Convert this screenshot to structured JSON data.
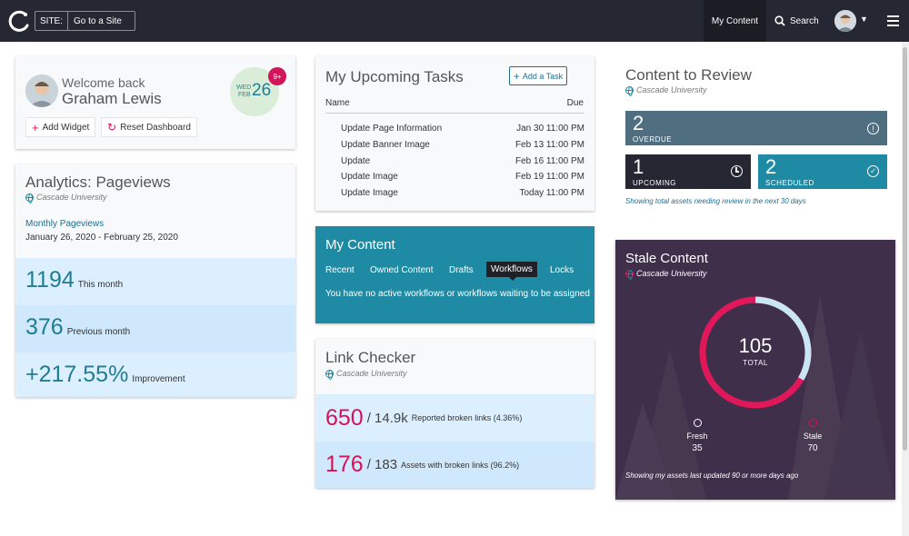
{
  "topbar": {
    "site_label": "SITE:",
    "site_value": "Go to a Site",
    "my_content": "My Content",
    "search": "Search"
  },
  "welcome": {
    "greeting": "Welcome back",
    "name": "Graham Lewis",
    "day": "WED",
    "month": "FEB",
    "date": "26",
    "badge": "9+",
    "add_widget": "Add Widget",
    "reset_dashboard": "Reset Dashboard"
  },
  "analytics": {
    "title": "Analytics: Pageviews",
    "site": "Cascade University",
    "link": "Monthly Pageviews",
    "range": "January 26, 2020 - February 25, 2020",
    "rows": [
      {
        "value": "1194",
        "label": "This month"
      },
      {
        "value": "376",
        "label": "Previous month"
      },
      {
        "value": "+217.55%",
        "label": "Improvement"
      }
    ]
  },
  "tasks": {
    "title": "My Upcoming Tasks",
    "add_label": "Add a Task",
    "col_name": "Name",
    "col_due": "Due",
    "items": [
      {
        "name": "Update Page Information",
        "due": "Jan 30 11:00 PM"
      },
      {
        "name": "Update Banner Image",
        "due": "Feb 13 11:00 PM"
      },
      {
        "name": "Update",
        "due": "Feb 16 11:00 PM"
      },
      {
        "name": "Update Image",
        "due": "Feb 19 11:00 PM"
      },
      {
        "name": "Update Image",
        "due": "Today 11:00 PM"
      }
    ]
  },
  "my_content": {
    "title": "My Content",
    "tabs": [
      "Recent",
      "Owned Content",
      "Drafts",
      "Workflows",
      "Locks"
    ],
    "active_tab": "Workflows",
    "message": "You have no active workflows or workflows waiting to be assigned"
  },
  "link_checker": {
    "title": "Link Checker",
    "site": "Cascade University",
    "rows": [
      {
        "value": "650",
        "total": "/ 14.9k",
        "label": "Reported broken links (4.36%)"
      },
      {
        "value": "176",
        "total": "/ 183",
        "label": "Assets with broken links (96.2%)"
      }
    ]
  },
  "review": {
    "title": "Content to Review",
    "site": "Cascade University",
    "overdue": {
      "value": "2",
      "label": "OVERDUE"
    },
    "upcoming": {
      "value": "1",
      "label": "UPCOMING"
    },
    "scheduled": {
      "value": "2",
      "label": "SCHEDULED"
    },
    "note": "Showing total assets needing review in the next 30 days"
  },
  "stale": {
    "title": "Stale Content",
    "site": "Cascade University",
    "total": "105",
    "total_label": "TOTAL",
    "fresh_label": "Fresh",
    "fresh_value": "35",
    "stale_label": "Stale",
    "stale_value": "70",
    "note": "Showing my assets last updated 90 or more days ago",
    "fresh_fraction": 0.333,
    "colors": {
      "fresh": "#c8e6f4",
      "stale": "#e0185a",
      "panel": "#3f2f4a"
    }
  },
  "colors": {
    "teal": "#1e8aa3",
    "accent": "#d2145a",
    "dark": "#252732",
    "slate": "#4f6f80"
  }
}
